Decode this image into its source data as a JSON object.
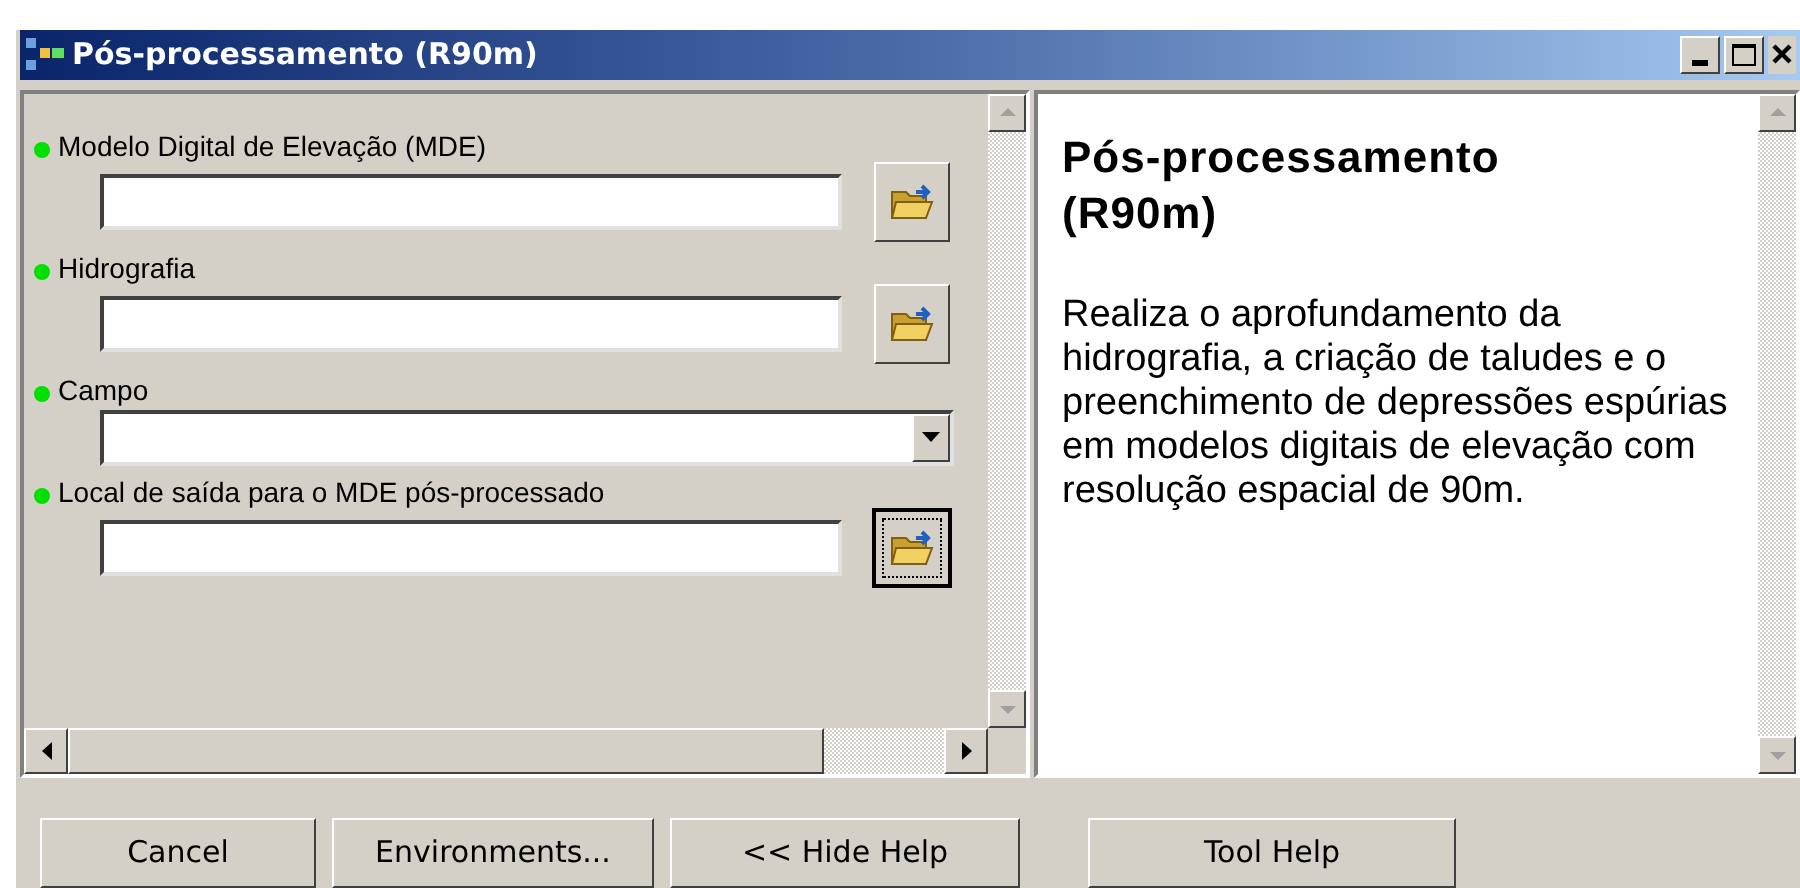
{
  "window": {
    "title": "Pós-processamento (R90m)"
  },
  "parameters": [
    {
      "label": "Modelo Digital de Elevação (MDE)",
      "kind": "file",
      "required": true,
      "focused": false
    },
    {
      "label": "Hidrografia",
      "kind": "file",
      "required": true,
      "focused": false
    },
    {
      "label": "Campo",
      "kind": "dropdown",
      "required": true,
      "focused": false
    },
    {
      "label": "Local de saída para o MDE pós-processado",
      "kind": "file",
      "required": true,
      "focused": true
    }
  ],
  "help": {
    "title": "Pós-processamento (R90m)",
    "body": "Realiza o aprofundamento da hidrografia, a criação de taludes e o preenchimento de depressões espúrias em modelos digitais de elevação com resolução espacial de 90m."
  },
  "buttons": [
    "Cancel",
    "Environments...",
    "<< Hide Help",
    "Tool Help"
  ]
}
